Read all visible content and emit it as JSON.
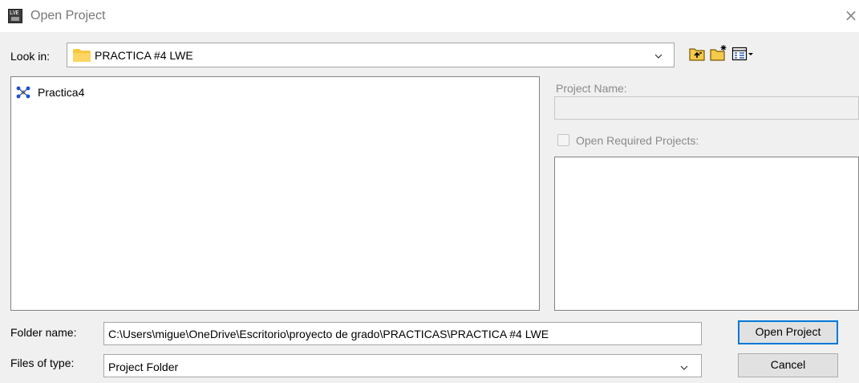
{
  "window": {
    "title": "Open Project",
    "close_glyph": "×",
    "icon_text": "LVE\nVI"
  },
  "look_in": {
    "label": "Look in:",
    "value": "PRACTICA #4 LWE",
    "icon": "folder-icon"
  },
  "toolbar": {
    "up_folder_icon": "up-folder-icon",
    "new_folder_icon": "new-folder-icon",
    "view_menu_icon": "view-menu-icon"
  },
  "file_list": {
    "items": [
      {
        "name": "Practica4",
        "icon": "labview-project-icon"
      }
    ]
  },
  "project_name": {
    "label": "Project Name:",
    "value": ""
  },
  "open_required": {
    "label": "Open Required Projects:",
    "checked": false
  },
  "folder_name": {
    "label": "Folder name:",
    "value": "C:\\Users\\migue\\OneDrive\\Escritorio\\proyecto de grado\\PRACTICAS\\PRACTICA #4 LWE"
  },
  "files_of_type": {
    "label": "Files of type:",
    "value": "Project Folder"
  },
  "buttons": {
    "open_label": "Open Project",
    "cancel_label": "Cancel"
  },
  "colors": {
    "dialog_bg": "#f0f0f0",
    "accent": "#0078d7",
    "folder_yellow": "#f8c73f",
    "project_icon_blue": "#1f4fd1"
  }
}
